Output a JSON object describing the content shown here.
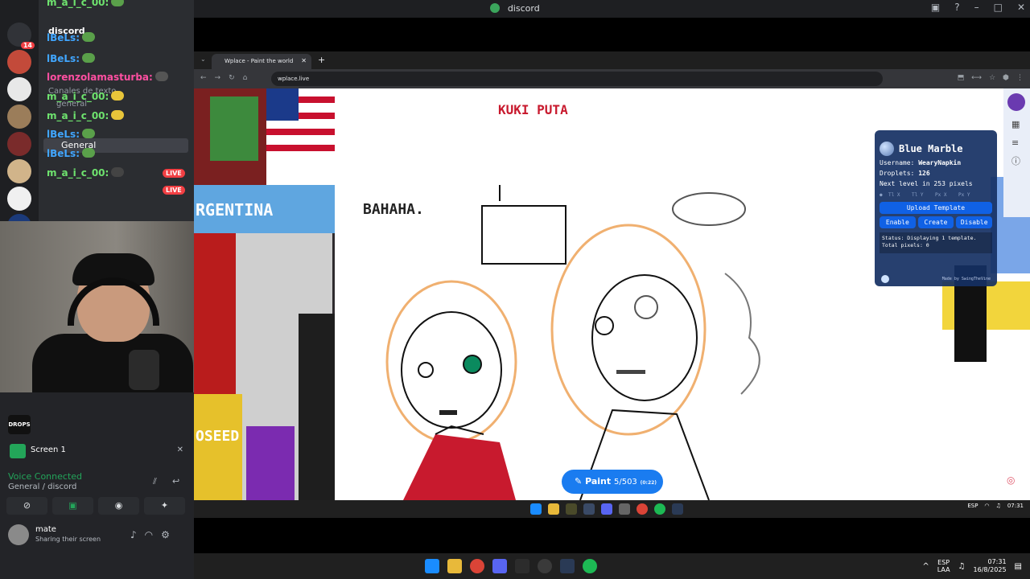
{
  "discord": {
    "title": "discord",
    "server_name": "discord",
    "guild_badge": "14",
    "chat": [
      {
        "name": "m_a_i_c_00:",
        "color": "green"
      },
      {
        "name": "lBeLs:",
        "color": "blue"
      },
      {
        "name": "lBeLs:",
        "color": "blue"
      },
      {
        "name": "lorenzolamasturba:",
        "color": "pink"
      },
      {
        "name": "m_a_i_c_00:",
        "color": "green"
      },
      {
        "name": "m_a_i_c_00:",
        "color": "green"
      },
      {
        "name": "lBeLs:",
        "color": "blue"
      },
      {
        "name": "lBeLs:",
        "color": "blue"
      },
      {
        "name": "m_a_i_c_00:",
        "color": "green"
      }
    ],
    "channels_label": "Canales de texto",
    "channel_general_text": "general",
    "voice_channel": "General",
    "live_label": "LIVE",
    "drops_label": "DROPS",
    "screen_label": "Screen 1",
    "voice_connected": "Voice Connected",
    "voice_location": "General / discord",
    "user_name": "mate",
    "user_status": "Sharing their screen"
  },
  "browser": {
    "tab_title": "Wplace - Paint the world",
    "url": "wplace.live"
  },
  "canvas": {
    "text_kuki": "KUKI PUTA",
    "text_bahaha": "BAHAHA.",
    "text_argentina": "RGENTINA",
    "text_seed": "OSEED"
  },
  "blue_marble": {
    "title": "Blue Marble",
    "username_label": "Username:",
    "username": "WearyNapkin",
    "droplets_label": "Droplets:",
    "droplets": "126",
    "next_level": "Next level in 253 pixels",
    "coord_placeholders": [
      "Tl X",
      "Tl Y",
      "Px X",
      "Px Y"
    ],
    "upload_label": "Upload Template",
    "enable_label": "Enable",
    "create_label": "Create",
    "disable_label": "Disable",
    "status_text": "Status: Displaying 1 template.",
    "status_text2": "Total pixels: 0",
    "made_by": "Made by SwingTheVine"
  },
  "paint_button": {
    "label": "Paint",
    "count": "5/503",
    "timer": "(0:22)"
  },
  "os_taskbar": {
    "lang": "ESP",
    "lang_sub": "LAA",
    "time": "07:31",
    "date": "16/8/2025"
  },
  "colors": {
    "discord_dark": "#1e1f22",
    "discord_mid": "#2b2d31",
    "voice_green": "#23a55a",
    "blue_marble_bg": "#153063",
    "paint_blue": "#1a7cf0"
  }
}
